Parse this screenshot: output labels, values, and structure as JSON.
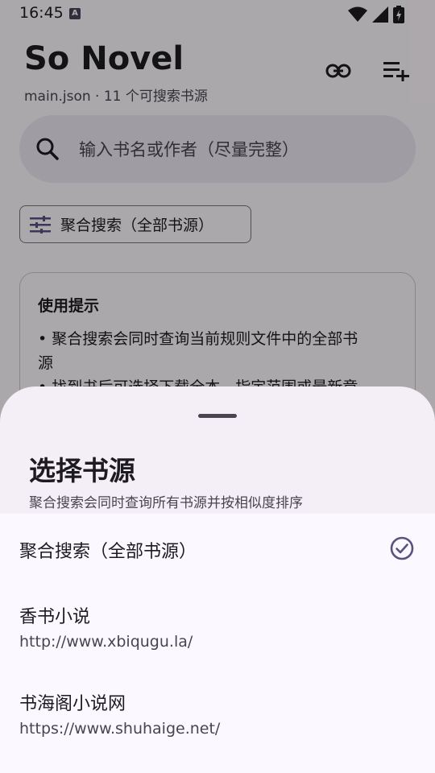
{
  "status_bar": {
    "time": "16:45",
    "a_badge": "A"
  },
  "header": {
    "title": "So Novel",
    "subtitle": "main.json · 11 个可搜索书源",
    "link_button": "link-icon",
    "add_list_button": "playlist-add-icon"
  },
  "search": {
    "placeholder": "输入书名或作者（尽量完整）"
  },
  "source_chip": {
    "label": "聚合搜索（全部书源）"
  },
  "tips": {
    "title": "使用提示",
    "line1": "• 聚合搜索会同时查询当前规则文件中的全部书",
    "line2": "源",
    "line3": "• 找到书后可选择下载全本、指定范围或最新章"
  },
  "sheet": {
    "title": "选择书源",
    "subtitle": "聚合搜索会同时查询所有书源并按相似度排序",
    "items": [
      {
        "title": "聚合搜索（全部书源）",
        "url": "",
        "selected": true
      },
      {
        "title": "香书小说",
        "url": "http://www.xbiqugu.la/",
        "selected": false
      },
      {
        "title": "书海阁小说网",
        "url": "https://www.shuhaige.net/",
        "selected": false
      }
    ]
  },
  "colors": {
    "accent": "#5b5280",
    "scrim": "rgba(0,0,0,0.32)"
  }
}
